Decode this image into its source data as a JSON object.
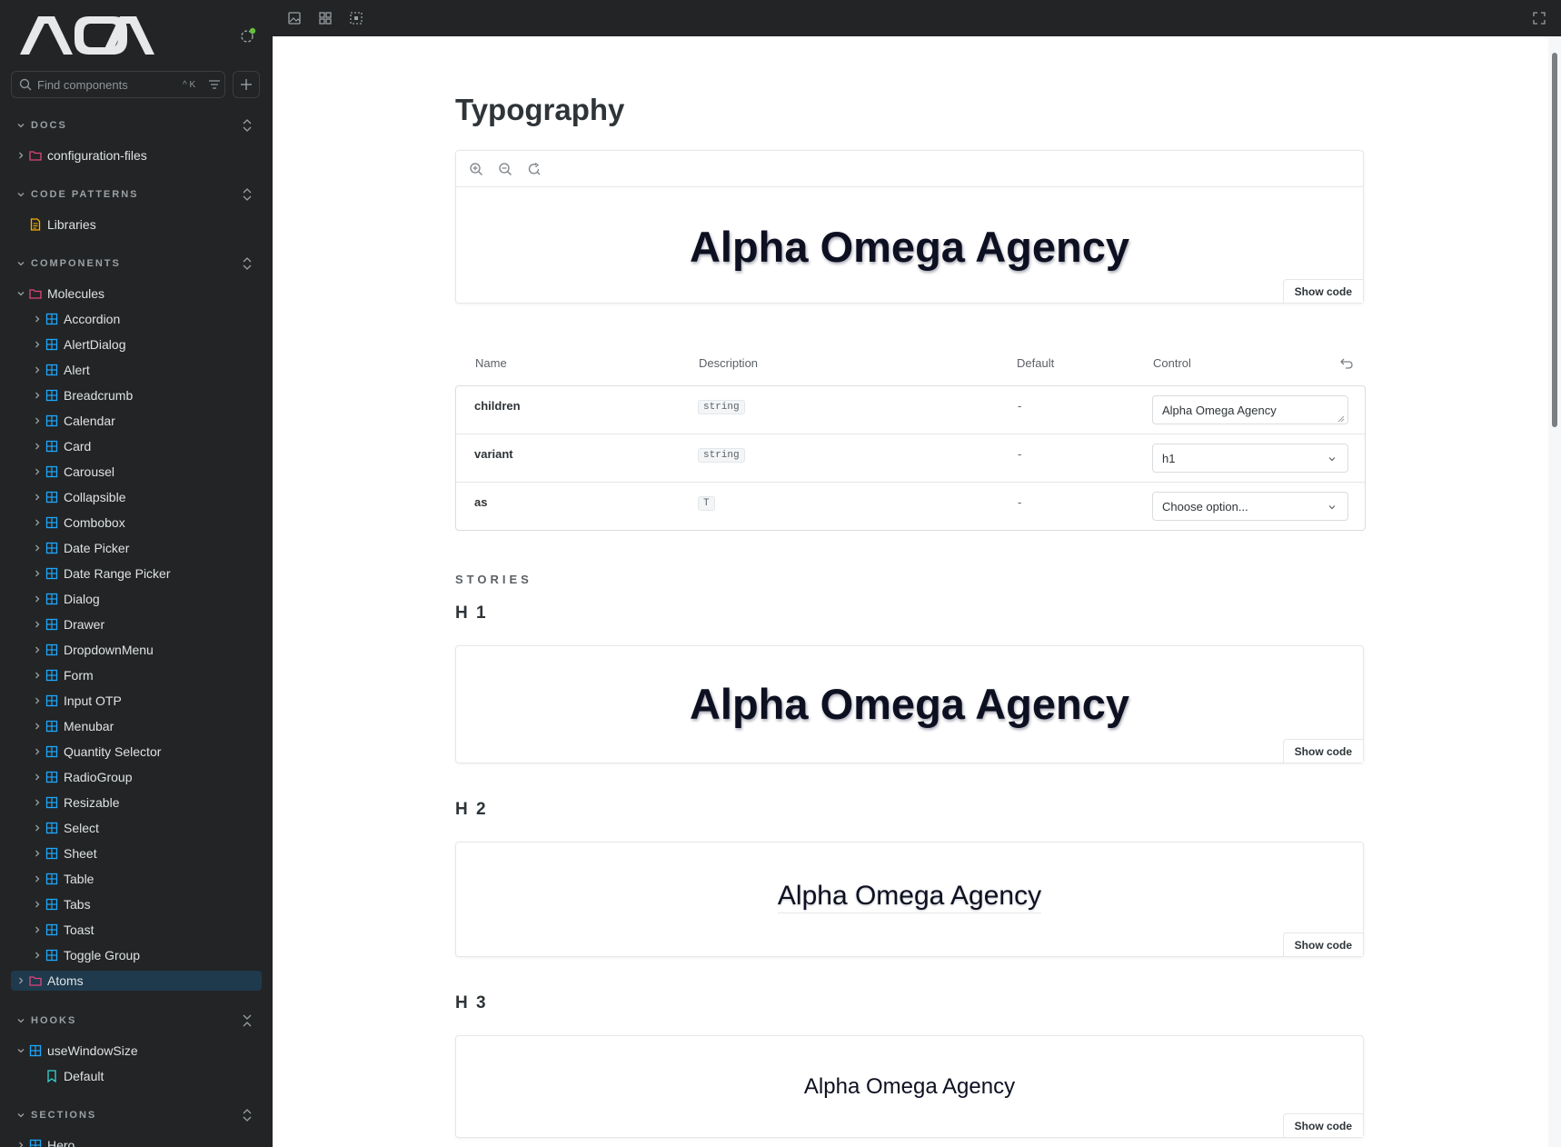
{
  "sidebar": {
    "logo_text": "AOA",
    "search_placeholder": "Find components",
    "search_shortcut": "^ K",
    "sections": [
      {
        "title": "DOCS"
      },
      {
        "title": "CODE PATTERNS"
      },
      {
        "title": "COMPONENTS"
      },
      {
        "title": "HOOKS"
      },
      {
        "title": "SECTIONS"
      }
    ],
    "docs_items": [
      "configuration-files"
    ],
    "code_patterns_items": [
      "Libraries"
    ],
    "molecules_label": "Molecules",
    "molecules": [
      "Accordion",
      "AlertDialog",
      "Alert",
      "Breadcrumb",
      "Calendar",
      "Card",
      "Carousel",
      "Collapsible",
      "Combobox",
      "Date Picker",
      "Date Range Picker",
      "Dialog",
      "Drawer",
      "DropdownMenu",
      "Form",
      "Input OTP",
      "Menubar",
      "Quantity Selector",
      "RadioGroup",
      "Resizable",
      "Select",
      "Sheet",
      "Table",
      "Tabs",
      "Toast",
      "Toggle Group"
    ],
    "atoms_label": "Atoms",
    "hooks_items": {
      "group": "useWindowSize",
      "story": "Default"
    },
    "sections_items": [
      "Hero"
    ]
  },
  "colors": {
    "sidebar_bg": "#222425",
    "folder": "#e0457b",
    "component": "#1ea7fd",
    "story": "#37d5d3",
    "doc": "#ffae00",
    "status": "#66bf3c",
    "selected_bg": "#1f3a4d"
  },
  "page": {
    "title": "Typography",
    "demo_text": "Alpha Omega Agency",
    "show_code": "Show code"
  },
  "args_table": {
    "headers": {
      "name": "Name",
      "description": "Description",
      "default": "Default",
      "control": "Control"
    },
    "rows": [
      {
        "name": "children",
        "type": "string",
        "default": "-",
        "control": "Alpha Omega Agency"
      },
      {
        "name": "variant",
        "type": "string",
        "default": "-",
        "control": "h1"
      },
      {
        "name": "as",
        "type": "T",
        "default": "-",
        "control": "Choose option..."
      }
    ]
  },
  "stories": {
    "label": "STORIES",
    "items": [
      {
        "title": "H 1",
        "text": "Alpha Omega Agency"
      },
      {
        "title": "H 2",
        "text": "Alpha Omega Agency"
      },
      {
        "title": "H 3",
        "text": "Alpha Omega Agency"
      }
    ]
  }
}
